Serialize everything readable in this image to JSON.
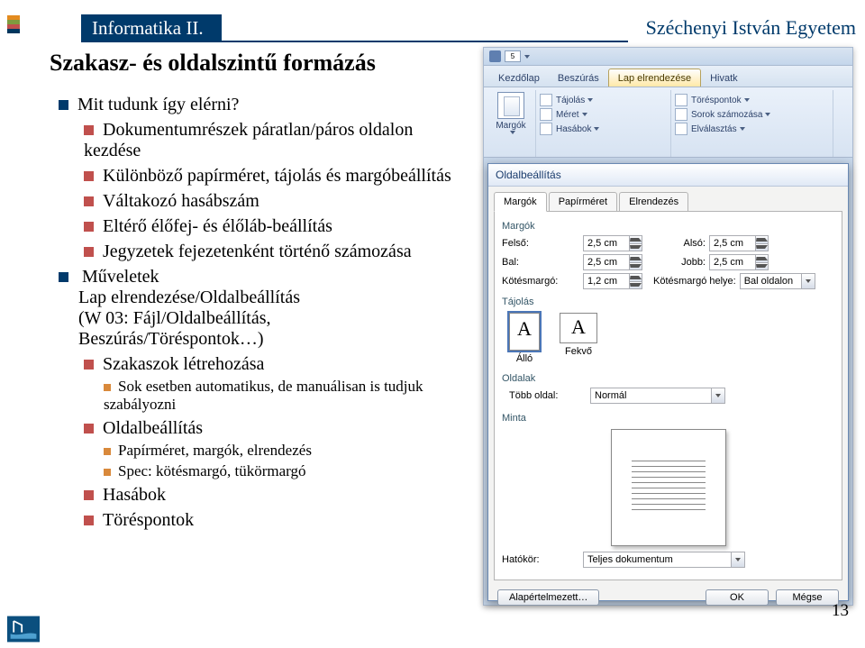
{
  "header": {
    "left": "Informatika II.",
    "right": "Széchenyi István Egyetem"
  },
  "title": "Szakasz- és oldalszintű formázás",
  "pageNumber": "13",
  "list": {
    "item1": "Mit tudunk így elérni?",
    "sub1a": "Dokumentumrészek páratlan/páros oldalon kezdése",
    "sub1b": "Különböző papírméret, tájolás és margóbeállítás",
    "sub1c": "Váltakozó hasábszám",
    "sub1d": "Eltérő élőfej- és élőláb-beállítás",
    "sub1e": "Jegyzetek fejezetenként történő számozása",
    "item2head": "Műveletek",
    "item2line1": "Lap elrendezése/Oldalbeállítás",
    "item2line2": "(W 03: Fájl/Oldalbeállítás,",
    "item2line3": "Beszúrás/Töréspontok…)",
    "sub2a": "Szakaszok létrehozása",
    "sub2a1": "Sok esetben automatikus, de manuálisan is tudjuk szabályozni",
    "sub2b": "Oldalbeállítás",
    "sub2b1": "Papírméret, margók, elrendezés",
    "sub2b2": "Spec: kötésmargó, tükörmargó",
    "sub2c": "Hasábok",
    "sub2d": "Töréspontok"
  },
  "word": {
    "qatZoom": "5",
    "tabs": {
      "t1": "Kezdőlap",
      "t2": "Beszúrás",
      "t3": "Lap elrendezése",
      "t4": "Hivatk"
    },
    "ribbon": {
      "margok": "Margók",
      "tajolas": "Tájolás",
      "meret": "Méret",
      "hasabok": "Hasábok",
      "torespontok": "Töréspontok",
      "sorok": "Sorok számozása",
      "elvalasztas": "Elválasztás"
    },
    "dialog": {
      "title": "Oldalbeállítás",
      "tabs": {
        "t1": "Margók",
        "t2": "Papírméret",
        "t3": "Elrendezés"
      },
      "secMargok": "Margók",
      "felso": "Felső:",
      "felsoVal": "2,5 cm",
      "bal": "Bal:",
      "balVal": "2,5 cm",
      "kotes": "Kötésmargó:",
      "kotesVal": "1,2 cm",
      "also": "Alsó:",
      "alsoVal": "2,5 cm",
      "jobb": "Jobb:",
      "jobbVal": "2,5 cm",
      "kotesHely": "Kötésmargó helye:",
      "kotesHelyVal": "Bal oldalon",
      "secTajolas": "Tájolás",
      "allo": "Álló",
      "fekvo": "Fekvő",
      "secOldalak": "Oldalak",
      "tobbOldal": "Több oldal:",
      "tobbOldalVal": "Normál",
      "secMinta": "Minta",
      "hatokor": "Hatókör:",
      "hatokorVal": "Teljes dokumentum",
      "btnDefault": "Alapértelmezett…",
      "btnOk": "OK",
      "btnCancel": "Mégse"
    }
  }
}
